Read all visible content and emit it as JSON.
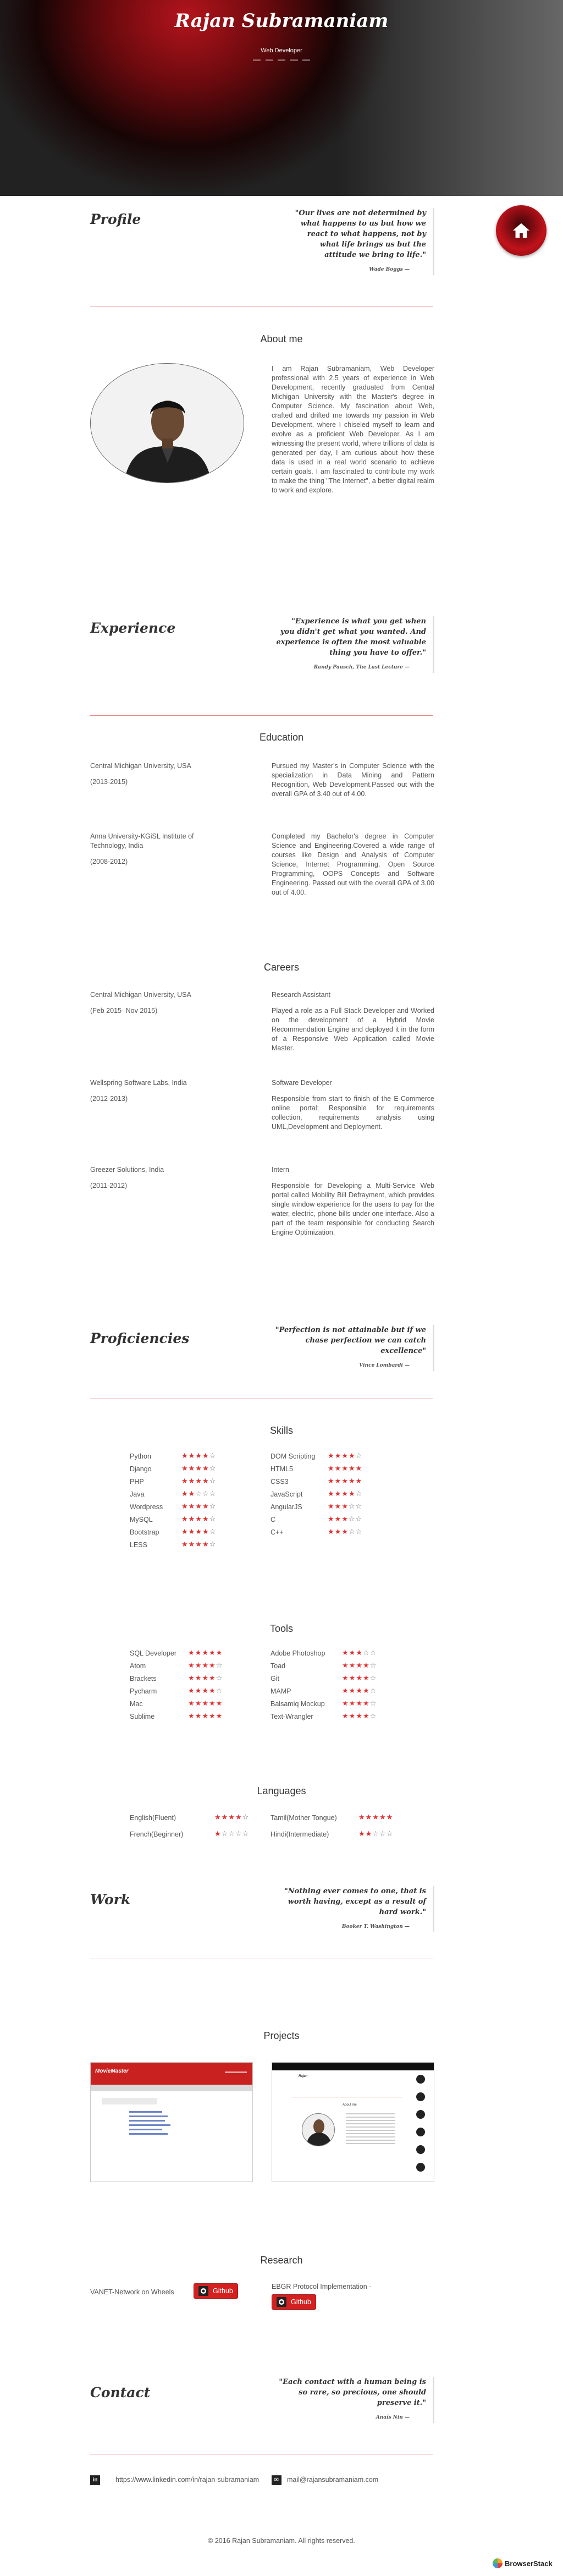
{
  "header": {
    "name": "Rajan Subramaniam",
    "subtitle": "Web Developer"
  },
  "profile": {
    "title": "Profile",
    "quote": "\"Our lives are not determined by what happens to us but how we react to what happens, not by what life brings us but the attitude we bring to life.\"",
    "quote_by": "Wade Boggs —"
  },
  "about": {
    "heading": "About me",
    "text": "I am Rajan Subramaniam, Web Developer professional with 2.5 years of experience in Web Development, recently graduated from Central Michigan University with the Master's degree in Computer Science. My fascination about Web, crafted and drifted me towards my passion in Web Development, where I chiseled myself to learn and evolve as a proficient Web Developer. As I am witnessing the present world, where trillions of data is generated per day, I am curious about how these data is used in a real world scenario to achieve certain goals. I am fascinated to contribute my work to make the thing \"The Internet\", a better digital realm to work and explore."
  },
  "experience": {
    "title": "Experience",
    "quote": "\"Experience is what you get when you didn't get what you wanted. And experience is often the most valuable thing you have to offer.\"",
    "quote_by": "Randy Pausch, The Last Lecture —"
  },
  "education": {
    "heading": "Education",
    "items": [
      {
        "school": "Central Michigan University, USA",
        "date": "(2013-2015)",
        "desc": "Pursued my Master's in Computer Science with the specialization in Data Mining and Pattern Recognition, Web Development.Passed out with the overall GPA of 3.40 out of 4.00."
      },
      {
        "school": "Anna University-KGiSL Institute of Technology, India",
        "date": "(2008-2012)",
        "desc": "Completed my Bachelor's degree in Computer Science and Engineering.Covered a wide range of courses like Design and Analysis of Computer Science, Internet Programming, Open Source Programming, OOPS Concepts and Software Engineering. Passed out with the overall GPA of 3.00 out of 4.00."
      }
    ]
  },
  "careers": {
    "heading": "Careers",
    "items": [
      {
        "company": "Central Michigan University, USA",
        "date": "(Feb 2015- Nov 2015)",
        "role": "Research Assistant",
        "desc": "Played a role as a Full Stack Developer and Worked on the development of a Hybrid Movie Recommendation Engine and deployed it in the form of a Responsive Web Application called Movie Master."
      },
      {
        "company": "Wellspring Software Labs, India",
        "date": "(2012-2013)",
        "role": "Software Developer",
        "desc": "Responsible from start to finish of the E-Commerce online portal; Responsible for requirements collection, requirements analysis using UML,Development and Deployment."
      },
      {
        "company": "Greezer Solutions, India",
        "date": "(2011-2012)",
        "role": "Intern",
        "desc": "Responsible for Developing a Multi-Service Web portal called Mobility Bill Defrayment, which provides single window experience for the users to pay for the water, electric, phone bills under one interface. Also a part of the team responsible for conducting Search Engine Optimization."
      }
    ]
  },
  "proficiencies": {
    "title": "Proficiencies",
    "quote": "\"Perfection is not attainable but if we chase perfection we can catch excellence\"",
    "quote_by": "Vince Lombardi —"
  },
  "skills": {
    "heading": "Skills",
    "left": [
      {
        "name": "Python",
        "rating": 4
      },
      {
        "name": "Django",
        "rating": 4
      },
      {
        "name": "PHP",
        "rating": 4
      },
      {
        "name": "Java",
        "rating": 2
      },
      {
        "name": "Wordpress",
        "rating": 4
      },
      {
        "name": "MySQL",
        "rating": 4
      },
      {
        "name": "Bootstrap",
        "rating": 4
      },
      {
        "name": "LESS",
        "rating": 4
      }
    ],
    "right": [
      {
        "name": "DOM Scripting",
        "rating": 4
      },
      {
        "name": "HTML5",
        "rating": 5
      },
      {
        "name": "CSS3",
        "rating": 5
      },
      {
        "name": "JavaScript",
        "rating": 4
      },
      {
        "name": "AngularJS",
        "rating": 3
      },
      {
        "name": "C",
        "rating": 3
      },
      {
        "name": "C++",
        "rating": 3
      }
    ]
  },
  "tools": {
    "heading": "Tools",
    "left": [
      {
        "name": "SQL Developer",
        "rating": 5
      },
      {
        "name": "Atom",
        "rating": 4
      },
      {
        "name": "Brackets",
        "rating": 4
      },
      {
        "name": "Pycharm",
        "rating": 4
      },
      {
        "name": "Mac",
        "rating": 5
      },
      {
        "name": "Sublime",
        "rating": 5
      }
    ],
    "right": [
      {
        "name": "Adobe Photoshop",
        "rating": 3
      },
      {
        "name": "Toad",
        "rating": 4
      },
      {
        "name": "Git",
        "rating": 4
      },
      {
        "name": "MAMP",
        "rating": 4
      },
      {
        "name": "Balsamiq Mockup",
        "rating": 4
      },
      {
        "name": "Text-Wrangler",
        "rating": 4
      }
    ]
  },
  "languages": {
    "heading": "Languages",
    "left": [
      {
        "name": "English(Fluent)",
        "rating": 4
      },
      {
        "name": "French(Beginner)",
        "rating": 1
      }
    ],
    "right": [
      {
        "name": "Tamil(Mother Tongue)",
        "rating": 5
      },
      {
        "name": "Hindi(Intermediate)",
        "rating": 2
      }
    ]
  },
  "work": {
    "title": "Work",
    "quote": "\"Nothing ever comes to one, that is worth having, except as a result of hard work.\"",
    "quote_by": "Booker T. Washington —"
  },
  "projects": {
    "heading": "Projects",
    "shot1_brand": "MovieMaster",
    "shot2_name": "Rajan",
    "shot2_heading": "About me"
  },
  "research": {
    "heading": "Research",
    "items": [
      {
        "title": "VANET-Network on Wheels",
        "button": "Github"
      },
      {
        "title": "EBGR Protocol Implementation -",
        "button": "Github"
      }
    ]
  },
  "contact": {
    "title": "Contact",
    "quote": "\"Each contact with a human being is so rare, so precious, one should preserve it.\"",
    "quote_by": "Anaïs Nin —",
    "linkedin": "https://www.linkedin.com/in/rajan-subramaniam",
    "email": "mail@rajansubramaniam.com"
  },
  "footer": {
    "copyright": "© 2016 Rajan Subramaniam. All rights reserved.",
    "badge": "BrowserStack"
  },
  "colors": {
    "accent": "#d4201f",
    "divider": "#e98a8a",
    "text": "#555555"
  }
}
